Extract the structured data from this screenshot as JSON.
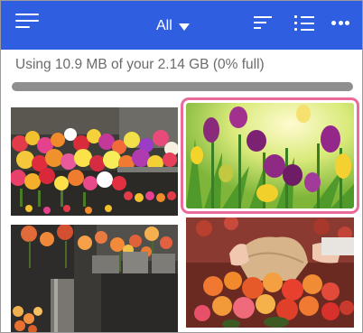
{
  "header": {
    "filter_label": "All",
    "icons": [
      "menu-icon",
      "chevron-down-icon",
      "sort-icon",
      "list-view-icon",
      "more-icon"
    ],
    "background": "#2f5fe0"
  },
  "storage": {
    "text": "Using 10.9 MB of your 2.14 GB (0% full)",
    "percent_used": 0,
    "fill_color": "#2f5fe0",
    "track_color": "#8f8f8f"
  },
  "photos": [
    {
      "subject": "flower market stall with tulip bunches",
      "selected": false
    },
    {
      "subject": "purple and yellow tulips",
      "selected": true
    },
    {
      "subject": "flower shop with vases and orange roses",
      "selected": false
    },
    {
      "subject": "hands arranging a bouquet of orange and pink roses",
      "selected": false
    }
  ],
  "colors": {
    "selection": "#ea6a9a"
  }
}
